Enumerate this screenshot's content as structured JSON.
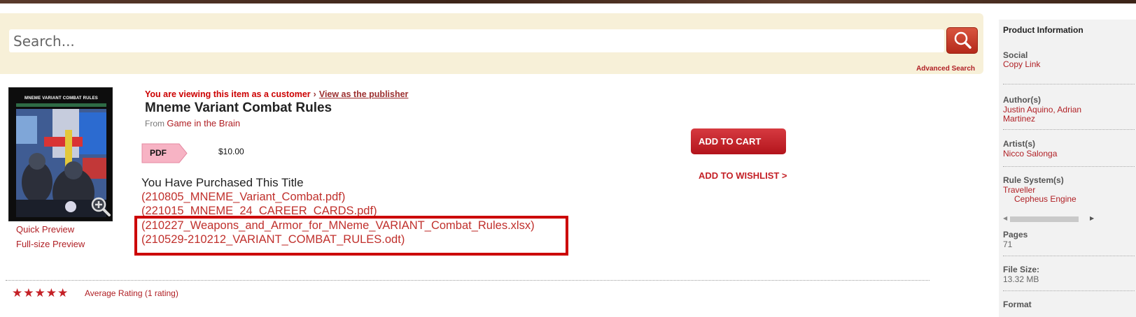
{
  "search": {
    "placeholder": "Search...",
    "advanced_label": "Advanced Search"
  },
  "cover": {
    "title": "MNEME VARIANT COMBAT RULES"
  },
  "previews": {
    "quick": "Quick Preview",
    "full": "Full-size Preview"
  },
  "banner": {
    "viewing_as": "You are viewing this item as a customer",
    "separator": "›",
    "view_as_publisher": "View as the publisher"
  },
  "product": {
    "title": "Mneme Variant Combat Rules",
    "from_label": "From",
    "publisher": "Game in the Brain",
    "format": "PDF",
    "price": "$10.00"
  },
  "purchase": {
    "heading": "You Have Purchased This Title",
    "files": [
      "(210805_MNEME_Variant_Combat.pdf)",
      "(221015_MNEME_24_CAREER_CARDS.pdf)",
      "(210227_Weapons_and_Armor_for_MNeme_VARIANT_Combat_Rules.xlsx)",
      "(210529-210212_VARIANT_COMBAT_RULES.odt)"
    ]
  },
  "actions": {
    "add_to_cart": "ADD TO CART",
    "add_to_wishlist": "ADD TO WISHLIST >"
  },
  "rating": {
    "stars": "★★★★★",
    "text": "Average Rating (1 rating)",
    "value": 5,
    "max": 5
  },
  "sidebar": {
    "heading": "Product Information",
    "social_label": "Social",
    "copy_link": "Copy Link",
    "authors_label": "Author(s)",
    "authors_line1": "Justin Aquino, Adrian",
    "authors_line2": "Martinez",
    "artists_label": "Artist(s)",
    "artist": "Nicco Salonga",
    "rule_label": "Rule System(s)",
    "rule1": "Traveller",
    "rule2": "Cepheus Engine",
    "pages_label": "Pages",
    "pages": "71",
    "filesize_label": "File Size:",
    "filesize": "13.32 MB",
    "format_label": "Format"
  },
  "colors": {
    "accent": "#b01f24",
    "search_band": "#f7f0d8",
    "highlight_border": "#cc0000"
  }
}
